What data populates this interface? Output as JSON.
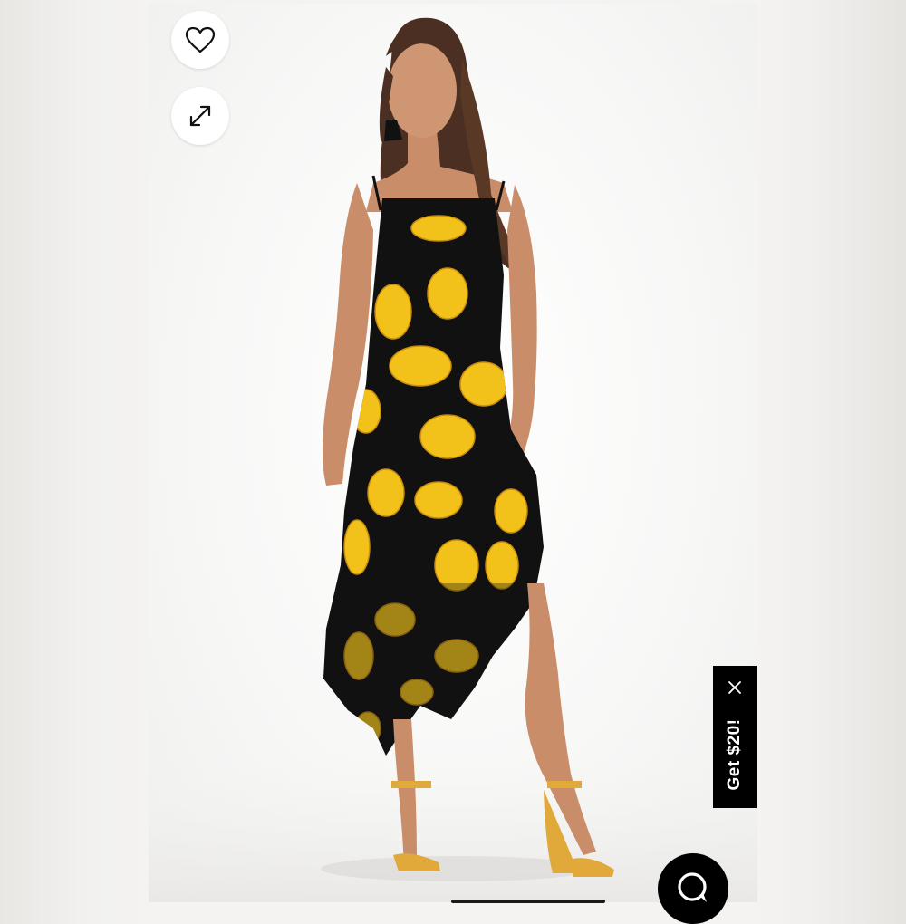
{
  "actions": {
    "like_icon": "heart-outline-icon",
    "expand_icon": "expand-arrows-icon"
  },
  "promo": {
    "label": "Get $20!",
    "close_icon": "close-icon"
  },
  "chat": {
    "icon": "chat-bubble-icon"
  },
  "colors": {
    "dress_base": "#111111",
    "dress_print": "#f2c21b",
    "sandals": "#e0a93a",
    "promo_bg": "#000000",
    "chat_bg": "#000000"
  }
}
